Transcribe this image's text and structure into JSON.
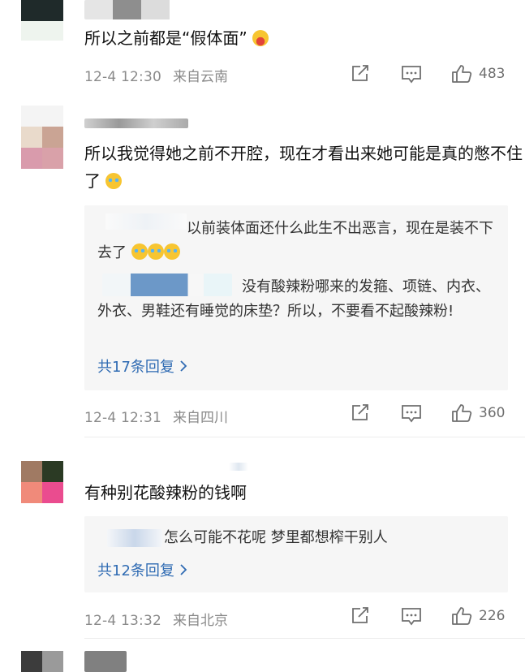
{
  "comments": [
    {
      "text": "所以之前都是“假体面”",
      "time": "12-4 12:30",
      "location": "来自云南",
      "likes": "483"
    },
    {
      "text": "所以我觉得她之前不开腔，现在才看出来她可能是真的憋不住了",
      "replies": [
        {
          "text": "以前装体面还什么此生不出恶言，现在是装不下去了"
        },
        {
          "text": "没有酸辣粉哪来的发箍、项链、内衣、外衣、男鞋还有睡觉的床垫？所以，不要看不起酸辣粉!"
        }
      ],
      "more_replies": "共17条回复",
      "time": "12-4 12:31",
      "location": "来自四川",
      "likes": "360"
    },
    {
      "text": "有种别花酸辣粉的钱啊",
      "replies": [
        {
          "text": "怎么可能不花呢 梦里都想榨干别人"
        }
      ],
      "more_replies": "共12条回复",
      "time": "12-4 13:32",
      "location": "来自北京",
      "likes": "226"
    }
  ],
  "colors": {
    "link": "#2f6bb3",
    "meta": "#8a8a8a",
    "quote_bg": "#f6f6f6"
  },
  "icons": [
    "share-icon",
    "comment-icon",
    "like-icon",
    "chevron-right-icon",
    "emoji-tongue-icon",
    "emoji-laugh-cry-icon"
  ]
}
